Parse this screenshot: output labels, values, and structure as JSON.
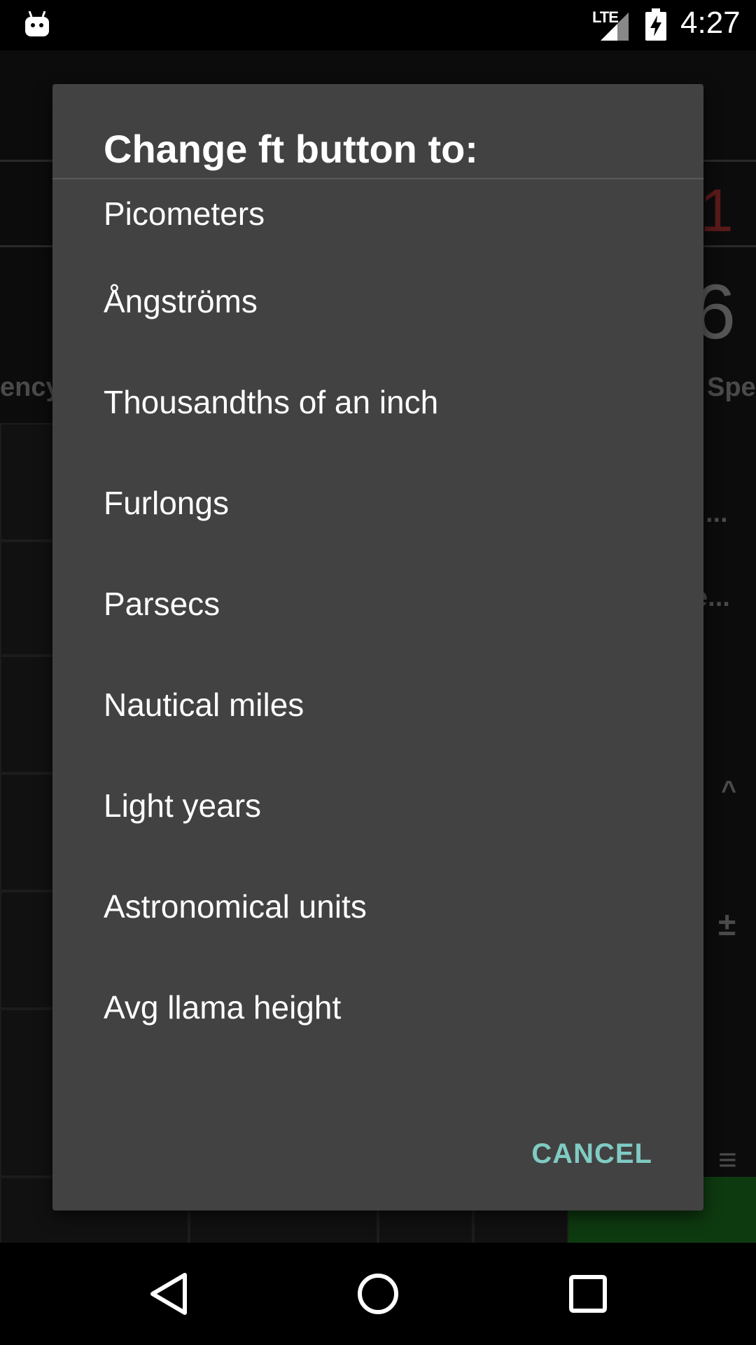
{
  "status_bar": {
    "network": "LTE",
    "time": "4:27"
  },
  "background": {
    "digits_top": "1",
    "digits_second": "6",
    "left_label": "ency",
    "right_label": "Spee",
    "right_ellipsis_1": "...",
    "right_ellipsis_2": "e...",
    "caret": "^",
    "plusminus": "±",
    "menu": "≡"
  },
  "dialog": {
    "title": "Change ft button to:",
    "options": [
      {
        "label": "Picometers"
      },
      {
        "label": "Ångströms"
      },
      {
        "label": "Thousandths of an inch"
      },
      {
        "label": "Furlongs"
      },
      {
        "label": "Parsecs"
      },
      {
        "label": "Nautical miles"
      },
      {
        "label": "Light years"
      },
      {
        "label": "Astronomical units"
      },
      {
        "label": "Avg llama height"
      }
    ],
    "cancel_label": "CANCEL"
  },
  "nav_bar": {
    "icons": [
      "back-icon",
      "home-icon",
      "recents-icon"
    ]
  },
  "colors": {
    "dialog_bg": "#424242",
    "accent": "#80cbc4"
  }
}
